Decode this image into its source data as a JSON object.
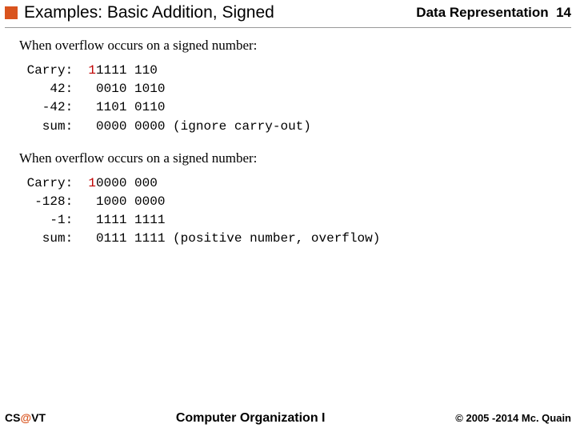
{
  "header": {
    "title": "Examples: Basic Addition, Signed",
    "section": "Data Representation",
    "page": "14"
  },
  "blocks": [
    {
      "intro": "When overflow occurs on a signed number:",
      "rows": [
        {
          "label": "Carry:",
          "col1_pre": "",
          "col1_red": "1",
          "col1_post": "1111",
          "col2": "110",
          "note": ""
        },
        {
          "label": "42:",
          "col1_pre": " 0010",
          "col1_red": "",
          "col1_post": "",
          "col2": "1010",
          "note": ""
        },
        {
          "label": "-42:",
          "col1_pre": " 1101",
          "col1_red": "",
          "col1_post": "",
          "col2": "0110",
          "note": ""
        },
        {
          "label": "sum:",
          "col1_pre": " 0000",
          "col1_red": "",
          "col1_post": "",
          "col2": "0000",
          "note": "(ignore carry-out)"
        }
      ]
    },
    {
      "intro": "When overflow occurs on a signed number:",
      "rows": [
        {
          "label": "Carry:",
          "col1_pre": "",
          "col1_red": "1",
          "col1_post": "0000",
          "col2": "000",
          "note": ""
        },
        {
          "label": "-128:",
          "col1_pre": " 1000",
          "col1_red": "",
          "col1_post": "",
          "col2": "0000",
          "note": ""
        },
        {
          "label": "-1:",
          "col1_pre": " 1111",
          "col1_red": "",
          "col1_post": "",
          "col2": "1111",
          "note": ""
        },
        {
          "label": "sum:",
          "col1_pre": " 0111",
          "col1_red": "",
          "col1_post": "",
          "col2": "1111",
          "note": "(positive number, overflow)"
        }
      ]
    }
  ],
  "footer": {
    "left_pre": "CS",
    "left_at": "@",
    "left_post": "VT",
    "center": "Computer Organization I",
    "right": "© 2005 -2014 Mc. Quain"
  }
}
